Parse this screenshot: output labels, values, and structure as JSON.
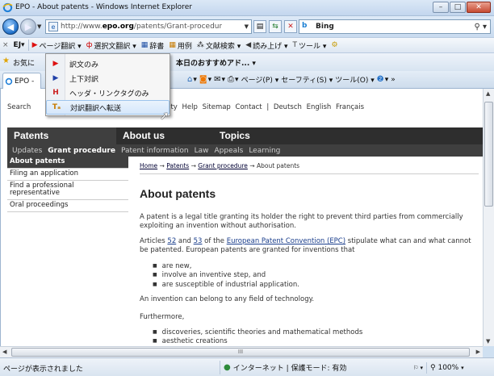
{
  "window": {
    "title": "EPO - About patents - Windows Internet Explorer",
    "buttons": {
      "minimize": "–",
      "maximize": "□",
      "close": "✕"
    }
  },
  "address_bar": {
    "url_prefix": "http://www.",
    "url_domain": "epo.org",
    "url_path": "/patents/Grant-procedur",
    "search_label": "Bing"
  },
  "translation_toolbar": {
    "close": "×",
    "brand": "EJ▾",
    "items": [
      {
        "label": "ページ翻訳 ▾"
      },
      {
        "label": "選択文翻訳 ▾"
      },
      {
        "label": "辞書"
      },
      {
        "label": "用例"
      },
      {
        "label": "文献検索 ▾"
      },
      {
        "label": "読み上げ ▾"
      },
      {
        "label": "ツール ▾"
      }
    ]
  },
  "favorites": {
    "label": "お気に",
    "recommended": "本日のおすすめアド... ▾"
  },
  "tab": {
    "label": "EPO -"
  },
  "command_bar": {
    "page": "ページ(P) ▾",
    "safety": "セーフティ(S) ▾",
    "tools": "ツール(O) ▾",
    "help": "▾",
    "more": "»"
  },
  "dropdown_menu": {
    "items": [
      {
        "label": "訳文のみ"
      },
      {
        "label": "上下対訳"
      },
      {
        "label": "ヘッダ・リンクタグのみ"
      },
      {
        "label": "対訳翻訳へ転送"
      }
    ]
  },
  "page": {
    "topline": [
      "Search",
      "ibility",
      "Help",
      "Sitemap",
      "Contact",
      "|",
      "Deutsch",
      "English",
      "Français"
    ],
    "main_nav": [
      "Patents",
      "About us",
      "Topics"
    ],
    "sub_nav": [
      "Updates",
      "Grant procedure",
      "Patent information",
      "Law",
      "Appeals",
      "Learning"
    ],
    "left_nav": [
      "About patents",
      "Filing an application",
      "Find a professional representative",
      "Oral proceedings"
    ],
    "breadcrumb": {
      "home": "Home",
      "arrow": "→",
      "patents": "Patents",
      "grant": "Grant procedure",
      "current": "About patents"
    },
    "heading": "About patents",
    "p1": "A patent is a legal title granting its holder the right to prevent third parties from commercially exploiting an invention without authorisation.",
    "p2": {
      "before": "Articles ",
      "a52": "52",
      "and": " and ",
      "a53": "53",
      "mid": " of the ",
      "epc": "European Patent Convention (EPC)",
      "after": " stipulate what can and what cannot be patented. European patents are granted for inventions that"
    },
    "list1": [
      "are new,",
      "involve an inventive step, and",
      "are susceptible of industrial application."
    ],
    "p3": "An invention can belong to any field of technology.",
    "p4": "Furthermore,",
    "list2": [
      "discoveries, scientific theories and mathematical methods",
      "aesthetic creations"
    ]
  },
  "scrollbar": {
    "grip": "III"
  },
  "status_bar": {
    "left": "ページが表示されました",
    "zone": "インターネット | 保護モード: 有効",
    "zoom": "100%"
  }
}
